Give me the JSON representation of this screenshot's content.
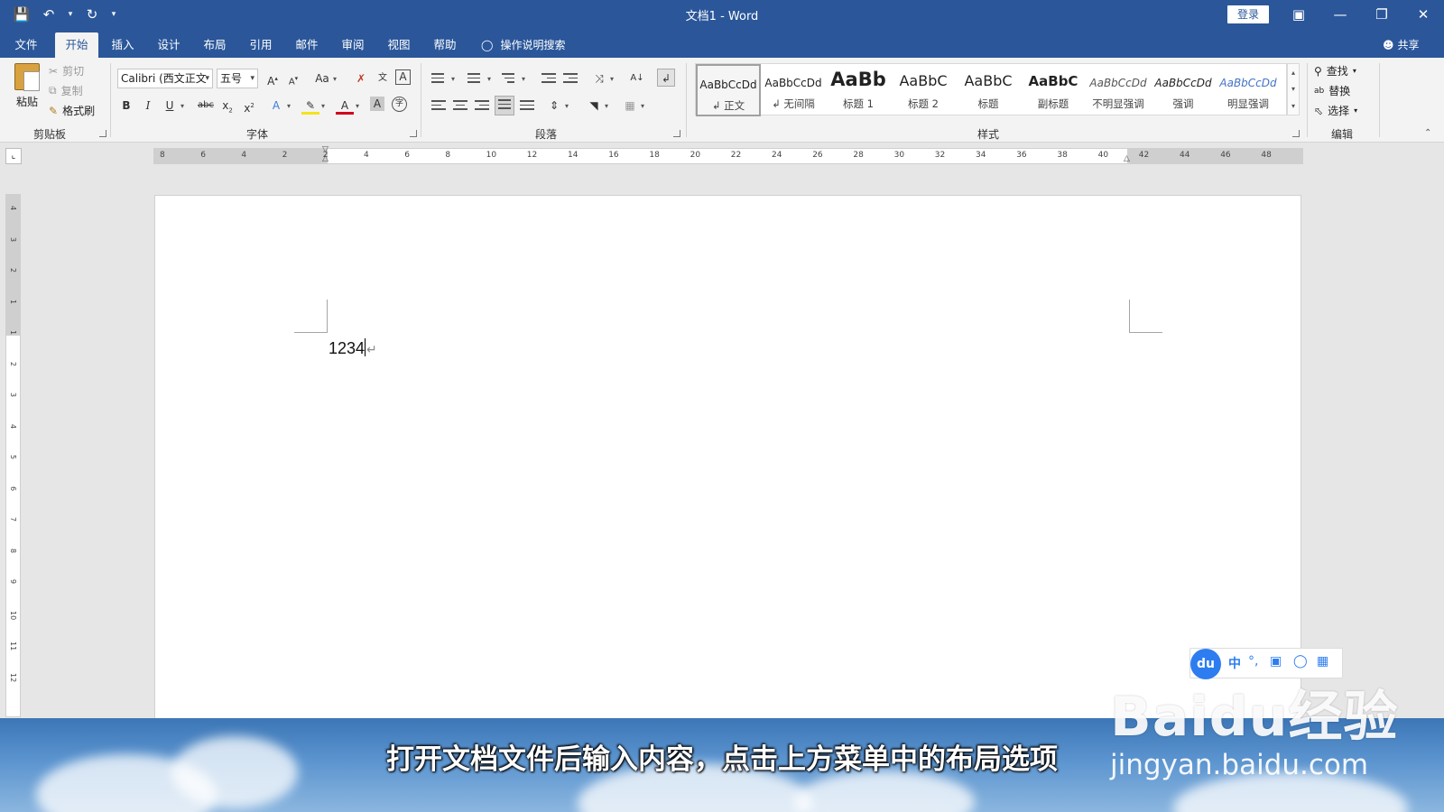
{
  "titlebar": {
    "doc_title": "文档1  -  Word",
    "login_label": "登录",
    "qat_icons": [
      "save-icon",
      "undo-icon",
      "redo-icon",
      "customize-icon"
    ]
  },
  "menu": {
    "tabs": [
      "文件",
      "开始",
      "插入",
      "设计",
      "布局",
      "引用",
      "邮件",
      "审阅",
      "视图",
      "帮助"
    ],
    "active_tab": "开始",
    "tell_me": "操作说明搜索",
    "share": "共享"
  },
  "clipboard": {
    "paste": "粘贴",
    "cut": "剪切",
    "copy": "复制",
    "format_painter": "格式刷",
    "label": "剪贴板"
  },
  "font": {
    "name": "Calibri (西文正文",
    "size": "五号",
    "label": "字体"
  },
  "paragraph": {
    "label": "段落"
  },
  "styles": {
    "label": "样式",
    "items": [
      {
        "sample": "AaBbCcDd",
        "name": "↲ 正文"
      },
      {
        "sample": "AaBbCcDd",
        "name": "↲ 无间隔"
      },
      {
        "sample": "AaBb",
        "name": "标题 1"
      },
      {
        "sample": "AaBbC",
        "name": "标题 2"
      },
      {
        "sample": "AaBbC",
        "name": "标题"
      },
      {
        "sample": "AaBbC",
        "name": "副标题"
      },
      {
        "sample": "AaBbCcDd",
        "name": "不明显强调"
      },
      {
        "sample": "AaBbCcDd",
        "name": "强调"
      },
      {
        "sample": "AaBbCcDd",
        "name": "明显强调"
      }
    ]
  },
  "editing": {
    "find": "查找",
    "replace": "替换",
    "select": "选择",
    "label": "编辑"
  },
  "ruler": {
    "h_ticks": [
      "8",
      "6",
      "4",
      "2",
      "2",
      "4",
      "6",
      "8",
      "10",
      "12",
      "14",
      "16",
      "18",
      "20",
      "22",
      "24",
      "26",
      "28",
      "30",
      "32",
      "34",
      "36",
      "38",
      "40",
      "42",
      "44",
      "46",
      "48"
    ],
    "v_ticks": [
      "4",
      "3",
      "2",
      "1",
      "1",
      "2",
      "3",
      "4",
      "5",
      "6",
      "7",
      "8",
      "9",
      "10",
      "11",
      "12"
    ]
  },
  "document": {
    "text": "1234"
  },
  "ime": {
    "logo": "du",
    "lang": "中"
  },
  "overlay": {
    "subtitle": "打开文档文件后输入内容，点击上方菜单中的布局选项",
    "watermark_logo": "Baidu经验",
    "watermark_url": "jingyan.baidu.com"
  },
  "colors": {
    "word_blue": "#2b579a",
    "ribbon_bg": "#f3f3f3",
    "canvas_bg": "#e6e6e6",
    "ime_blue": "#2d7df0"
  }
}
